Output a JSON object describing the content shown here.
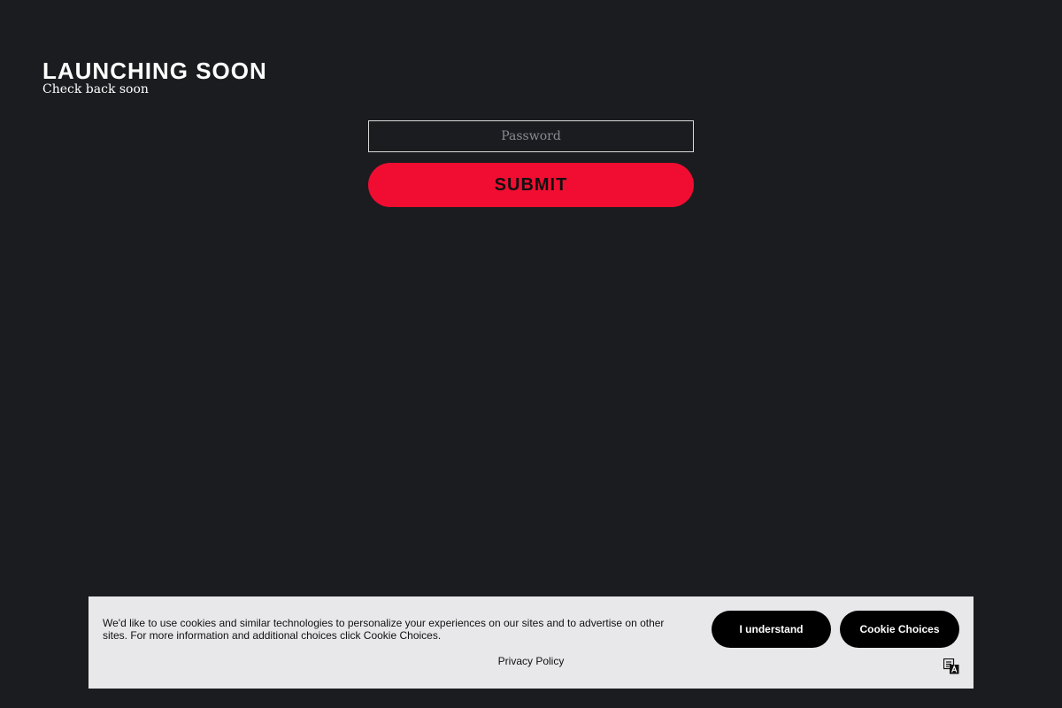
{
  "header": {
    "title": "LAUNCHING SOON",
    "subtitle": "Check back soon"
  },
  "password_form": {
    "password_placeholder": "Password",
    "password_value": "",
    "submit_label": "SUBMIT"
  },
  "cookie_banner": {
    "message": "We'd like to use cookies and similar technologies to personalize your experiences on our sites and to advertise on other sites. For more information and additional choices click Cookie Choices.",
    "understand_label": "I understand",
    "choices_label": "Cookie Choices",
    "privacy_link_label": "Privacy Policy",
    "translate_icon": "translate-icon"
  },
  "colors": {
    "background": "#1b1c20",
    "accent": "#f10d31",
    "banner_background": "#e8e8ea",
    "banner_button": "#000000"
  }
}
